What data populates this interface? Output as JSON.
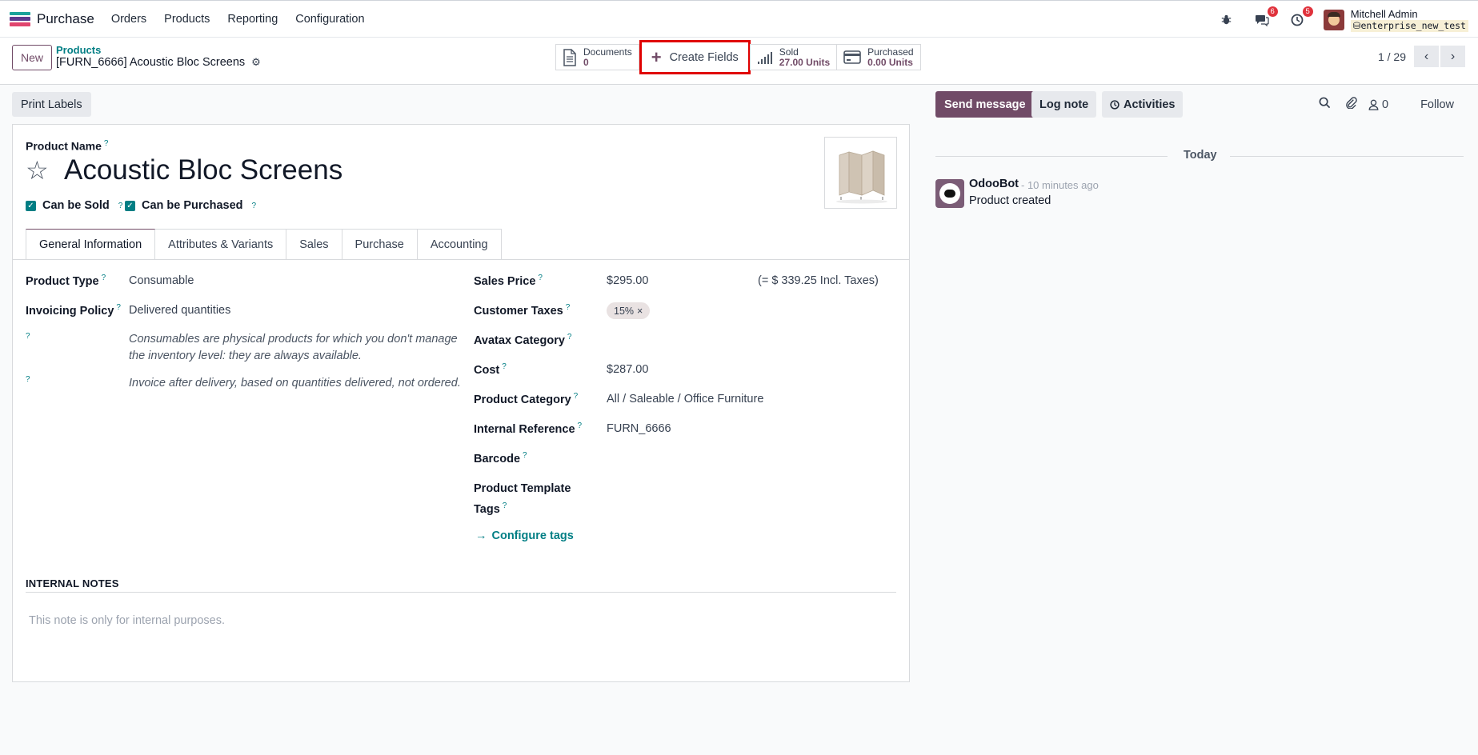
{
  "app": {
    "name": "Purchase",
    "icon_colors": [
      "#1aa39a",
      "#5b3a8e",
      "#e0456e"
    ]
  },
  "nav_menu": [
    "Orders",
    "Products",
    "Reporting",
    "Configuration"
  ],
  "systray": {
    "messages_badge": "6",
    "activities_badge": "5",
    "user_name": "Mitchell Admin",
    "db_name": "enterprise_new_test"
  },
  "control": {
    "new_label": "New",
    "breadcrumb": "Products",
    "record_name": "[FURN_6666] Acoustic Bloc Screens",
    "smart_buttons": {
      "documents_label": "Documents",
      "documents_value": "0",
      "create_fields_label": "Create Fields",
      "sold_label": "Sold",
      "sold_value": "27.00 Units",
      "purchased_label": "Purchased",
      "purchased_value": "0.00 Units"
    },
    "pager": "1 / 29"
  },
  "form": {
    "print_labels": "Print Labels",
    "product_name_label": "Product Name",
    "product_name": "Acoustic Bloc Screens",
    "can_be_sold": "Can be Sold",
    "can_be_purchased": "Can be Purchased",
    "tabs": [
      "General Information",
      "Attributes & Variants",
      "Sales",
      "Purchase",
      "Accounting"
    ],
    "product_type_label": "Product Type",
    "product_type": "Consumable",
    "invoicing_policy_label": "Invoicing Policy",
    "invoicing_policy": "Delivered quantities",
    "help_consumable": "Consumables are physical products for which you don't manage the inventory level: they are always available.",
    "help_invoice": "Invoice after delivery, based on quantities delivered, not ordered.",
    "sales_price_label": "Sales Price",
    "sales_price": "$295.00",
    "incl_taxes": "(= $ 339.25 Incl. Taxes)",
    "customer_taxes_label": "Customer Taxes",
    "customer_tax_tag": "15%",
    "avatax_category_label": "Avatax Category",
    "cost_label": "Cost",
    "cost": "$287.00",
    "product_category_label": "Product Category",
    "product_category": "All / Saleable / Office Furniture",
    "internal_reference_label": "Internal Reference",
    "internal_reference": "FURN_6666",
    "barcode_label": "Barcode",
    "template_tags_label_1": "Product Template",
    "template_tags_label_2": "Tags",
    "configure_tags": "Configure tags",
    "internal_notes_title": "INTERNAL NOTES",
    "internal_notes_placeholder": "This note is only for internal purposes."
  },
  "chatter": {
    "send_message": "Send message",
    "log_note": "Log note",
    "activities": "Activities",
    "followers_count": "0",
    "follow": "Follow",
    "date_separator": "Today",
    "message_author": "OdooBot",
    "message_time": "- 10 minutes ago",
    "message_body": "Product created"
  }
}
